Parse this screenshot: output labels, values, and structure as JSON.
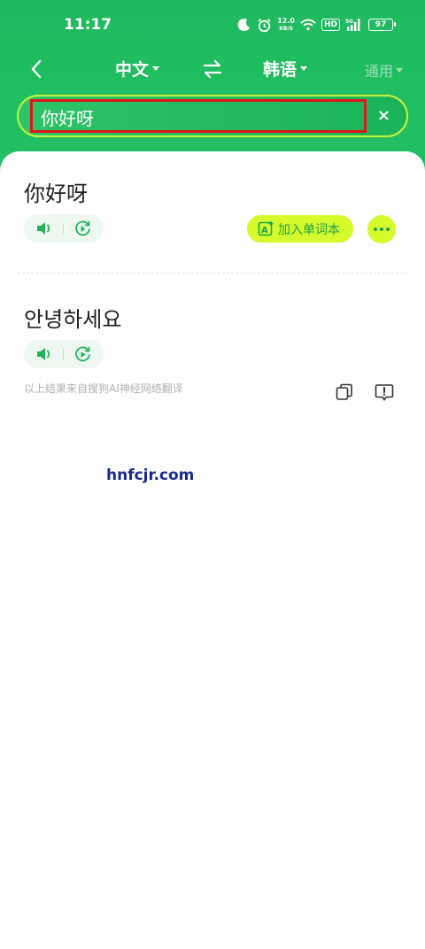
{
  "status_bar": {
    "time": "11:17",
    "speed_value": "12.0",
    "speed_unit": "KB/S",
    "hd": "HD",
    "network": "5G",
    "battery": "97",
    "icons": [
      "moon-icon",
      "alarm-icon",
      "wifi-icon",
      "signal-icon",
      "battery-icon"
    ]
  },
  "toolbar": {
    "source_lang": "中文",
    "target_lang": "韩语",
    "mode": "通用"
  },
  "search": {
    "value": "你好呀",
    "clear_label": "×"
  },
  "result": {
    "source_text": "你好呀",
    "target_text": "안녕하세요",
    "add_word_label": "加入单词本",
    "attribution": "以上结果来自搜狗AI神经网络翻译"
  },
  "watermark": "hnfcjr.com",
  "colors": {
    "header_green": "#1fba5f",
    "accent_lime": "#d6fb2d",
    "accent_green": "#19a24b",
    "highlight_red": "#e0141b"
  }
}
